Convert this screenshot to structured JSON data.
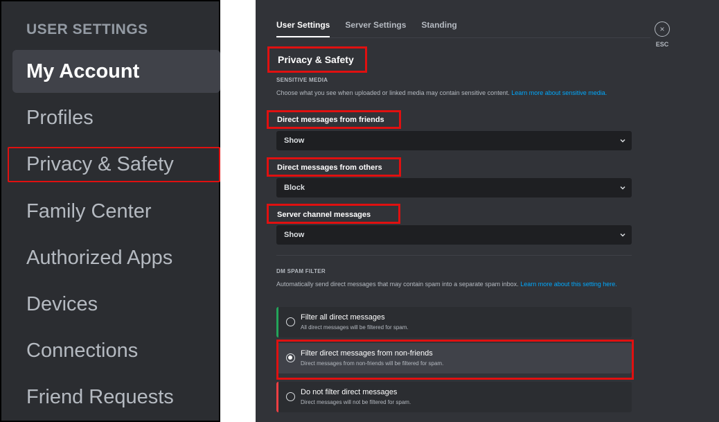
{
  "sidebar": {
    "header": "USER SETTINGS",
    "items": [
      {
        "label": "My Account"
      },
      {
        "label": "Profiles"
      },
      {
        "label": "Privacy & Safety"
      },
      {
        "label": "Family Center"
      },
      {
        "label": "Authorized Apps"
      },
      {
        "label": "Devices"
      },
      {
        "label": "Connections"
      },
      {
        "label": "Friend Requests"
      }
    ]
  },
  "tabs": [
    {
      "label": "User Settings"
    },
    {
      "label": "Server Settings"
    },
    {
      "label": "Standing"
    }
  ],
  "close": {
    "glyph": "×",
    "label": "ESC"
  },
  "page": {
    "title": "Privacy & Safety",
    "sensitive_media": {
      "heading": "SENSITIVE MEDIA",
      "description": "Choose what you see when uploaded or linked media may contain sensitive content.",
      "link": "Learn more about sensitive media.",
      "friends": {
        "label": "Direct messages from friends",
        "value": "Show"
      },
      "others": {
        "label": "Direct messages from others",
        "value": "Block"
      },
      "server": {
        "label": "Server channel messages",
        "value": "Show"
      }
    },
    "spam_filter": {
      "heading": "DM SPAM FILTER",
      "description": "Automatically send direct messages that may contain spam into a separate spam inbox.",
      "link": "Learn more about this setting here.",
      "options": [
        {
          "title": "Filter all direct messages",
          "desc": "All direct messages will be filtered for spam.",
          "accent": "#23a55a"
        },
        {
          "title": "Filter direct messages from non-friends",
          "desc": "Direct messages from non-friends will be filtered for spam.",
          "accent": "#f0b232"
        },
        {
          "title": "Do not filter direct messages",
          "desc": "Direct messages will not be filtered for spam.",
          "accent": "#f23f43"
        }
      ],
      "selected_index": 1
    }
  },
  "colors": {
    "highlight": "#e01010",
    "link": "#00a8fc"
  }
}
